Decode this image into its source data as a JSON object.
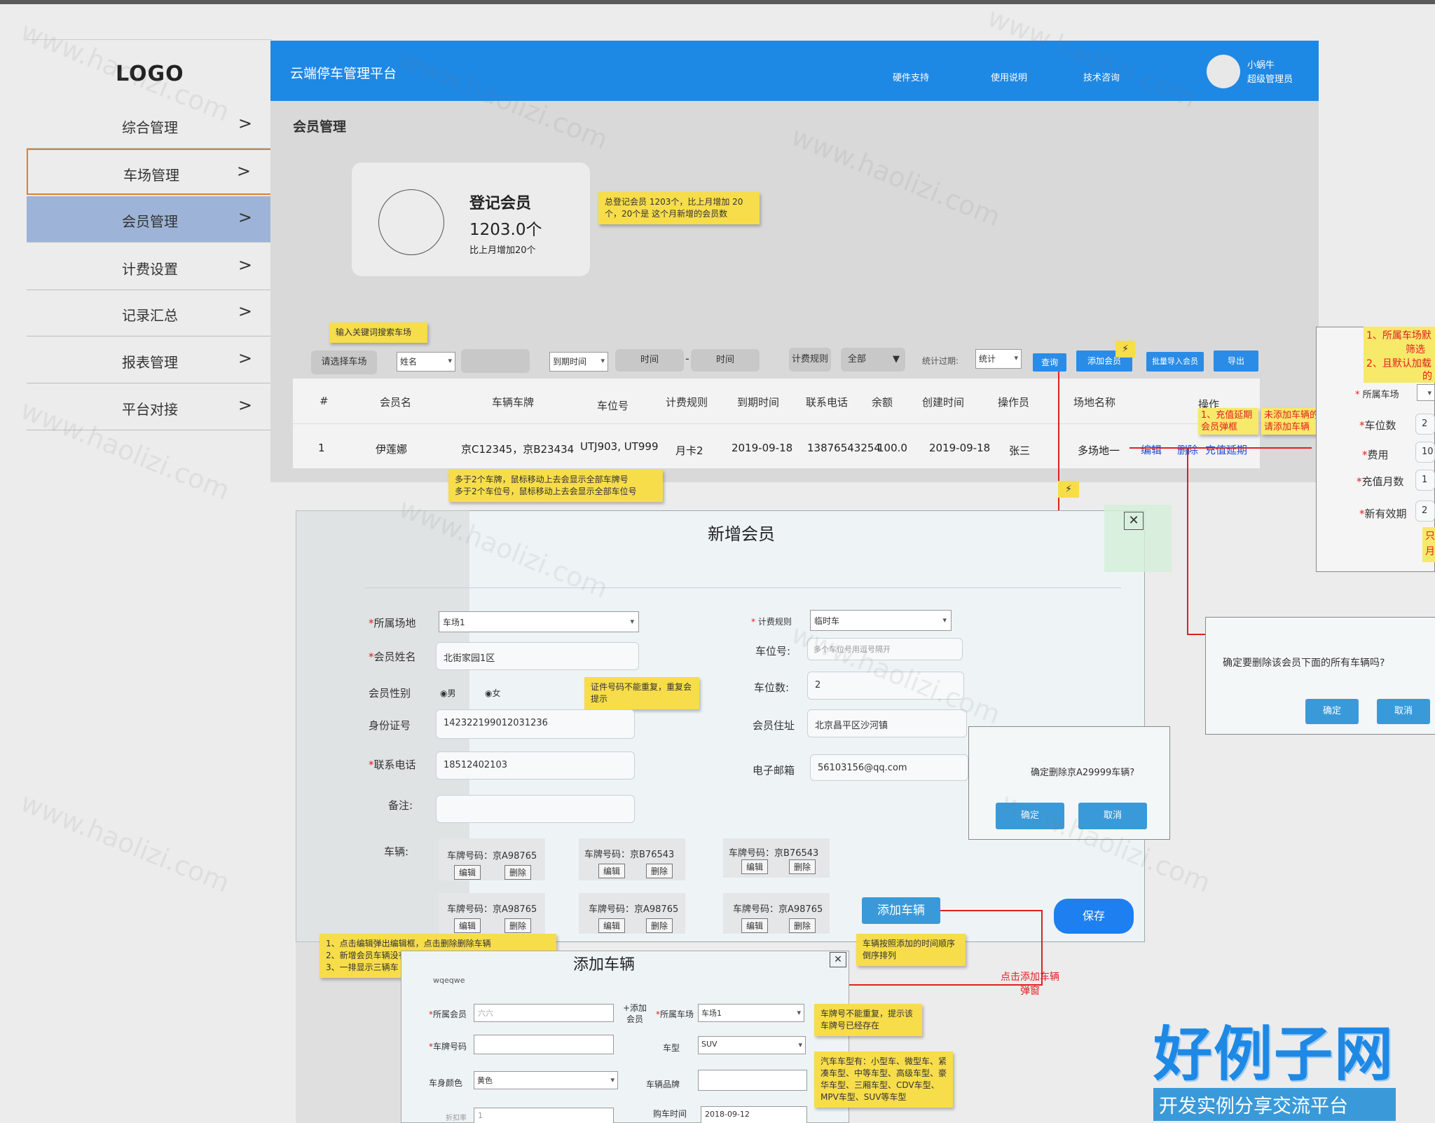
{
  "sidebar": {
    "logo": "LOGO",
    "items": [
      {
        "label": "综合管理",
        "icon": "chevron-right-icon"
      },
      {
        "label": "车场管理",
        "icon": "chevron-right-icon"
      },
      {
        "label": "会员管理",
        "icon": "chevron-right-icon"
      },
      {
        "label": "计费设置",
        "icon": "chevron-right-icon"
      },
      {
        "label": "记录汇总",
        "icon": "chevron-right-icon"
      },
      {
        "label": "报表管理",
        "icon": "chevron-right-icon"
      },
      {
        "label": "平台对接",
        "icon": "chevron-right-icon"
      }
    ],
    "chevron": ">"
  },
  "header": {
    "title": "云端停车管理平台",
    "links": [
      "硬件支持",
      "使用说明",
      "技术咨询"
    ],
    "user_name": "小蜗牛",
    "user_role": "超级管理员",
    "color": "#1e88e5"
  },
  "page": {
    "title": "会员管理"
  },
  "stat": {
    "title": "登记会员",
    "value": "1203.0个",
    "sub": "比上月增加20个"
  },
  "notes": {
    "stat_note": "总登记会员 1203个，比上月增加 20 个，20个是 这个月新增的会员数",
    "search_note": "输入关键词搜索车场",
    "plate_note_1": "多于2个车牌，鼠标移动上去会显示全部车牌号",
    "plate_note_2": "多于2个车位号，鼠标移动上去会显示全部车位号",
    "id_note": "证件号码不能重复，重复会提示",
    "car_note_1": "1、点击编辑弹出编辑框，点击删除删除车辆",
    "car_note_2": "2、新增会员车辆没有编辑按钮，编辑会员有编辑按钮",
    "car_note_3": "3、一排显示三辆车",
    "order_note": "车辆按照添加的时间顺序倒序排列",
    "plate_dup_note": "车牌号不能重复，提示该车牌号已经存在",
    "car_type_note": "汽车车型有：小型车、微型车、紧凑车型、中等车型、高级车型、豪华车型、三厢车型、CDV车型、MPV车型、SUV等车型",
    "click_add_note": "点击添加车辆弹窗",
    "recharge_note_1": "1、充值延期",
    "recharge_note_2": "会员弹框",
    "no_car_note_1": "未添加车辆的",
    "no_car_note_2": "请添加车辆"
  },
  "filters": {
    "park_btn": "请选择车场",
    "name_select": "姓名",
    "due_select": "到期时间",
    "time_from": "时间",
    "dash": "-",
    "time_to": "时间",
    "rule_label": "计费规则",
    "rule_select": "全部",
    "expired_label": "统计过期:",
    "expired_select": "统计",
    "query_btn": "查询",
    "add_btn": "添加会员",
    "import_btn": "批量导入会员",
    "export_btn": "导出"
  },
  "table": {
    "headers": [
      "#",
      "会员名",
      "车辆车牌",
      "车位号",
      "计费规则",
      "到期时间",
      "联系电话",
      "余额",
      "创建时间",
      "操作员",
      "场地名称",
      "操作"
    ],
    "row": {
      "no": "1",
      "name": "伊莲娜",
      "plates": "京C12345，京B23434",
      "spaces": "UTJ903, UT999",
      "rule": "月卡2",
      "due": "2019-09-18",
      "phone": "13876543254",
      "balance": "100.0",
      "created": "2019-09-18",
      "operator": "张三",
      "site": "多场地一",
      "actions": [
        "编辑",
        "删除",
        "充值延期"
      ]
    }
  },
  "member_modal": {
    "title": "新增会员",
    "site_label": "所属场地",
    "site_value": "车场1",
    "name_label": "会员姓名",
    "name_value": "北街家园1区",
    "gender_label": "会员性别",
    "gender_male": "男",
    "gender_female": "女",
    "id_label": "身份证号",
    "id_value": "142322199012031236",
    "phone_label": "联系电话",
    "phone_value": "18512402103",
    "remark_label": "备注:",
    "vehicles_label": "车辆:",
    "rule_label": "计费规则",
    "rule_value": "临时车",
    "space_label": "车位号:",
    "space_placeholder": "多个车位号用逗号隔开",
    "space_count_label": "车位数:",
    "space_count_value": "2",
    "address_label": "会员住址",
    "address_value": "北京昌平区沙河镇",
    "email_label": "电子邮箱",
    "email_value": "56103156@qq.com",
    "cars": [
      {
        "plate": "车牌号码：京A98765",
        "edit": "编辑",
        "del": "删除"
      },
      {
        "plate": "车牌号码：京B76543",
        "edit": "编辑",
        "del": "删除"
      },
      {
        "plate": "车牌号码：京B76543",
        "edit": "编辑",
        "del": "删除"
      },
      {
        "plate": "车牌号码：京A98765",
        "edit": "编辑",
        "del": "删除"
      },
      {
        "plate": "车牌号码：京A98765",
        "edit": "编辑",
        "del": "删除"
      },
      {
        "plate": "车牌号码：京A98765",
        "edit": "编辑",
        "del": "删除"
      }
    ],
    "add_car_btn": "添加车辆",
    "save_btn": "保存"
  },
  "confirm_vehicle": {
    "text": "确定删除京A29999车辆?",
    "ok": "确定",
    "cancel": "取消"
  },
  "confirm_member": {
    "text": "确定要删除该会员下面的所有车辆吗?",
    "ok": "确定",
    "cancel": "取消"
  },
  "right_panel": {
    "note1": "1、所属车场默",
    "note1b": "筛选",
    "note2": "2、且默认加载",
    "note2b": "的",
    "site_label": "所属车场",
    "space_count_label": "车位数",
    "space_count_value": "2",
    "fee_label": "费用",
    "fee_value": "10",
    "months_label": "充值月数",
    "months_value": "1",
    "valid_label": "新有效期",
    "valid_value": "2",
    "side_note": "只",
    "side_note2": "月"
  },
  "vehicle_modal": {
    "title": "添加车辆",
    "tag": "wqeqwe",
    "member_label": "所属会员",
    "member_value": "六六",
    "add_member": "+添加会员",
    "park_label": "所属车场",
    "park_value": "车场1",
    "plate_label": "车牌号码",
    "type_label": "车型",
    "type_value": "SUV",
    "color_label": "车身颜色",
    "color_value": "黄色",
    "brand_label": "车辆品牌",
    "buy_label": "购车时间",
    "buy_value": "2018-09-12",
    "discount_label": "折扣率",
    "discount_value": "1"
  },
  "watermark": "www.haolizi.com",
  "brand": {
    "title": "好例子网",
    "subtitle": "开发实例分享交流平台"
  }
}
